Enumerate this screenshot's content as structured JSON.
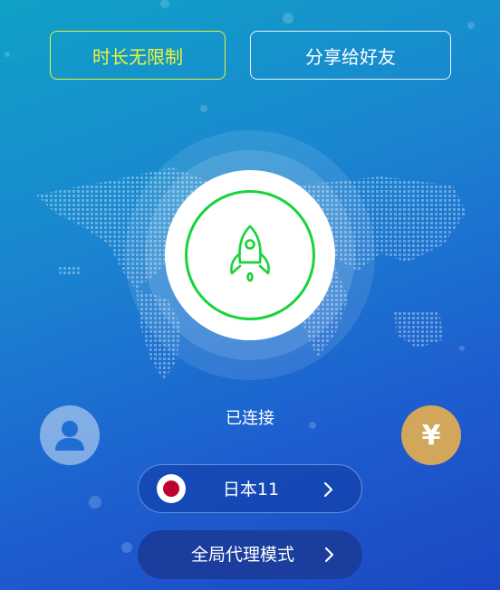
{
  "buttons": {
    "unlimited_label": "时长无限制",
    "share_label": "分享给好友"
  },
  "connection": {
    "status": "已连接"
  },
  "server": {
    "name": "日本11",
    "flag": "japan-flag-icon"
  },
  "mode": {
    "label": "全局代理模式"
  },
  "payment": {
    "symbol": "¥"
  },
  "icons": {
    "connect": "rocket-icon",
    "user": "user-icon",
    "chevron": "chevron-right-icon"
  },
  "colors": {
    "accent_yellow": "#eef53a",
    "connected_green": "#18d33a",
    "pay_gold": "#d2a65b",
    "flag_red": "#bd0030"
  }
}
